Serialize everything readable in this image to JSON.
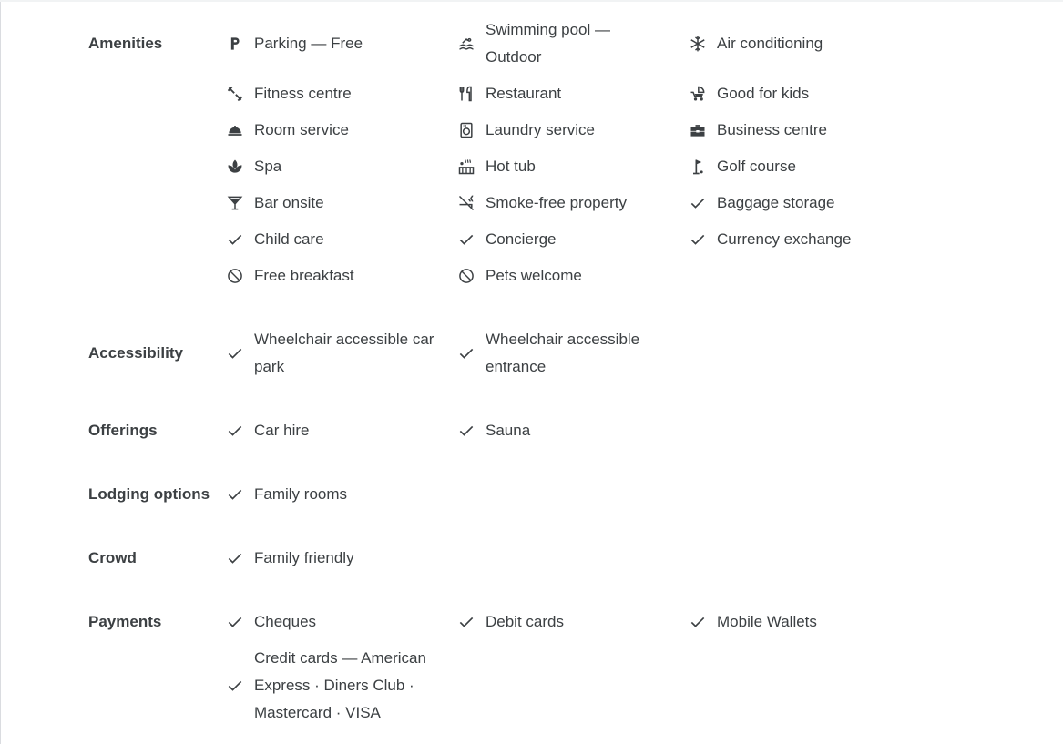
{
  "amenities": {
    "label": "Amenities",
    "items": [
      {
        "text": "Parking — Free",
        "icon": "parking-icon"
      },
      {
        "text": "Swimming pool — Outdoor",
        "icon": "pool-icon"
      },
      {
        "text": "Air conditioning",
        "icon": "snowflake-icon"
      },
      {
        "text": "Fitness centre",
        "icon": "fitness-icon"
      },
      {
        "text": "Restaurant",
        "icon": "restaurant-icon"
      },
      {
        "text": "Good for kids",
        "icon": "stroller-icon"
      },
      {
        "text": "Room service",
        "icon": "room-service-icon"
      },
      {
        "text": "Laundry service",
        "icon": "laundry-icon"
      },
      {
        "text": "Business centre",
        "icon": "briefcase-icon"
      },
      {
        "text": "Spa",
        "icon": "spa-icon"
      },
      {
        "text": "Hot tub",
        "icon": "hot-tub-icon"
      },
      {
        "text": "Golf course",
        "icon": "golf-icon"
      },
      {
        "text": "Bar onsite",
        "icon": "cocktail-icon"
      },
      {
        "text": "Smoke-free property",
        "icon": "smoke-free-icon"
      },
      {
        "text": "Baggage storage",
        "icon": "check-icon"
      },
      {
        "text": "Child care",
        "icon": "check-icon"
      },
      {
        "text": "Concierge",
        "icon": "check-icon"
      },
      {
        "text": "Currency exchange",
        "icon": "check-icon"
      },
      {
        "text": "Free breakfast",
        "icon": "not-available-icon"
      },
      {
        "text": "Pets welcome",
        "icon": "not-available-icon"
      }
    ]
  },
  "accessibility": {
    "label": "Accessibility",
    "items": [
      {
        "text": "Wheelchair accessible car park",
        "icon": "check-icon"
      },
      {
        "text": "Wheelchair accessible entrance",
        "icon": "check-icon"
      }
    ]
  },
  "offerings": {
    "label": "Offerings",
    "items": [
      {
        "text": "Car hire",
        "icon": "check-icon"
      },
      {
        "text": "Sauna",
        "icon": "check-icon"
      }
    ]
  },
  "lodging": {
    "label": "Lodging options",
    "items": [
      {
        "text": "Family rooms",
        "icon": "check-icon"
      }
    ]
  },
  "crowd": {
    "label": "Crowd",
    "items": [
      {
        "text": "Family friendly",
        "icon": "check-icon"
      }
    ]
  },
  "payments": {
    "label": "Payments",
    "items": [
      {
        "text": "Cheques",
        "icon": "check-icon"
      },
      {
        "text": "Debit cards",
        "icon": "check-icon"
      },
      {
        "text": "Mobile Wallets",
        "icon": "check-icon"
      },
      {
        "text": "Credit cards — American Express · Diners Club · Mastercard · VISA",
        "icon": "check-icon"
      }
    ]
  }
}
